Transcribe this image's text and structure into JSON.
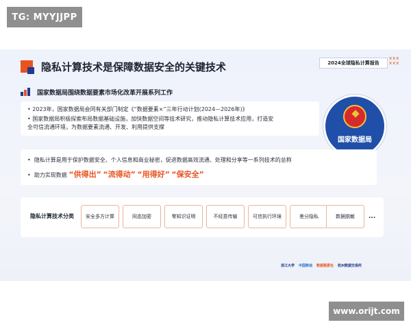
{
  "watermarks": {
    "top": "TG: MYYJJPP",
    "bottom": "www.orijt.com"
  },
  "slide": {
    "title": "隐私计算技术是保障数据安全的关键技术",
    "report_badge": "2024全球隐私计算报告",
    "subtitle": "国家数据局围绕数据要素市场化改革开展系列工作",
    "bullets_top": [
      "• 2023年，国家数据局会同有关部门制定《“数据要素×”三年行动计划(2024—2026年)》",
      "• 国家数据局积极探索布局数据基础设施，加快数据空间等技术研究，推动隐私计算技术应用，打造安",
      "  全可信流通环境，为数据要素流通、开发、利用提供支撑"
    ],
    "emblem_name": "国家数据局",
    "bullet_def": "隐私计算是用于保护数据安全、个人信息和商业秘密，促进数据高效流通、处理和分享等一系列技术的总称",
    "bullet_goal_prefix": "助力实现数据",
    "highlights": [
      "“供得出”",
      "“流得动”",
      "“用得好”",
      "“保安全”"
    ],
    "category_label": "隐私计算技术分类",
    "categories": [
      "安全多方计算",
      "同态加密",
      "零知识证明",
      "不经意传输",
      "可信执行环境",
      "差分隐私",
      "数据脱敏"
    ],
    "ellipsis": "...",
    "logos": [
      "浙江大学",
      "中国移动",
      "数据要素社",
      "杭州数据交易所"
    ]
  },
  "colors": {
    "accent": "#e8531f",
    "brand": "#1f3a8f",
    "emblem": "#1f4fa8"
  }
}
